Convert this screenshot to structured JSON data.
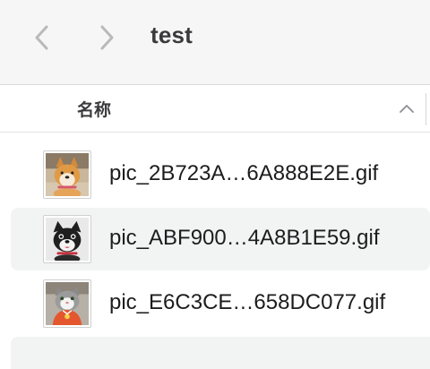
{
  "window": {
    "title": "test",
    "back_icon": "chevron-left-icon",
    "forward_icon": "chevron-right-icon"
  },
  "column_header": {
    "name_label": "名称",
    "sort_icon": "chevron-up-icon"
  },
  "files": [
    {
      "name": "pic_2B723A…6A888E2E.gif",
      "thumbnail": "shiba-dog-thumbnail"
    },
    {
      "name": "pic_ABF900…4A8B1E59.gif",
      "thumbnail": "black-dog-thumbnail"
    },
    {
      "name": "pic_E6C3CE…658DC077.gif",
      "thumbnail": "cat-orange-outfit-thumbnail"
    }
  ],
  "colors": {
    "toolbar_bg": "#f6f6f6",
    "alt_row_bg": "#f2f4f3",
    "text": "#1d1d1f"
  }
}
